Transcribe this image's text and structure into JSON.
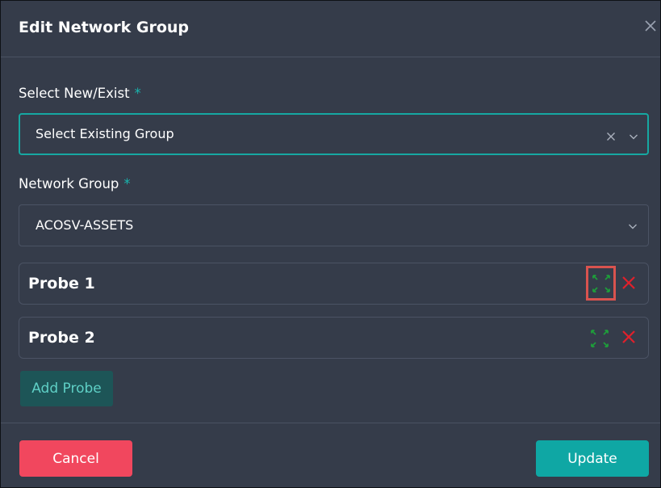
{
  "dialog": {
    "title": "Edit Network Group"
  },
  "select_mode": {
    "label": "Select New/Exist",
    "required_mark": "*",
    "value": "Select Existing Group"
  },
  "network_group": {
    "label": "Network Group",
    "required_mark": "*",
    "value": "ACOSV-ASSETS"
  },
  "probes": [
    {
      "name": "Probe 1",
      "expand_icon": "expand-arrows-icon",
      "remove_icon": "close-icon"
    },
    {
      "name": "Probe 2",
      "expand_icon": "expand-arrows-icon",
      "remove_icon": "close-icon"
    }
  ],
  "actions": {
    "add_probe_label": "Add Probe",
    "cancel_label": "Cancel",
    "update_label": "Update"
  },
  "colors": {
    "accent_teal": "#0fa7a4",
    "danger_red": "#f1475e",
    "icon_green": "#1e9e3a",
    "icon_red": "#e0202b"
  }
}
